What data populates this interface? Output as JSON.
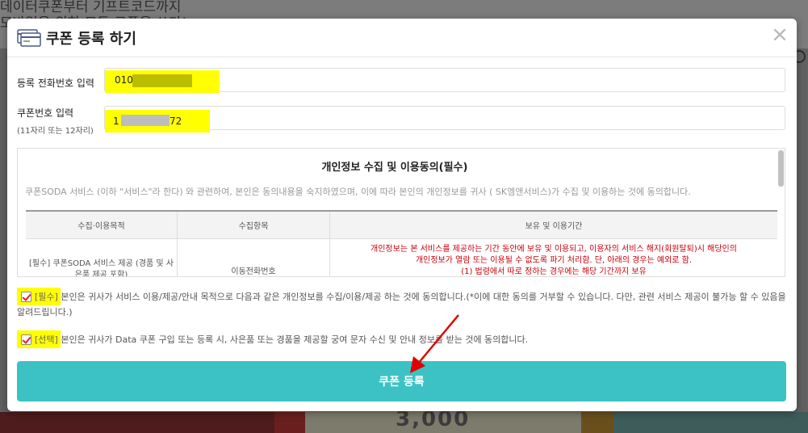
{
  "background": {
    "line1": "데이터쿠폰부터 기프트코드까지",
    "line2": "모바일을 위한 모든 쿠폰을 쓰다!",
    "bottom_amount": "3,000"
  },
  "modal": {
    "title": "쿠폰 등록 하기",
    "close_glyph": "×"
  },
  "form": {
    "phone_label": "등록 전화번호 입력",
    "phone_value": "010",
    "coupon_label": "쿠폰번호 입력",
    "coupon_sub": "(11자리 또는 12자리)",
    "coupon_value_start": "1",
    "coupon_value_end": "72"
  },
  "terms": {
    "title": "개인정보 수집 및 이용동의(필수)",
    "description": "쿠폰SODA 서비스 (이하 \"서비스\"라 한다) 와 관련하여, 본인은 동의내용을 숙지하였으며, 이에 따라 본인의 개인정보를 귀사 ( SK엠앤서비스)가 수집 및 이용하는 것에 동의합니다.",
    "headers": [
      "수집·이용목적",
      "수집항목",
      "보유 및 이용기간"
    ],
    "row": {
      "purpose": "[필수] 쿠폰SODA 서비스 제공 (경품 및 사은품 제공 포함)",
      "items": "이동전화번호",
      "retention_1": "개인정보는 본 서비스를 제공하는 기간 동안에 보유 및 이용되고, 이용자의 서비스 해지(회원탈퇴)시 해당인의",
      "retention_2": "개인정보가 열람 또는 이용될 수 없도록 파기 처리함. 단, 아래의 경우는 예외로 함.",
      "retention_3": "(1) 법령에서 따로 정하는 경우에는 해당 기간까지 보유"
    }
  },
  "agreements": {
    "required_tag": "[필수]",
    "required_text": " 본인은 귀사가 서비스 이용/제공/안내 목적으로 다음과 같은 개인정보를 수집/이용/제공 하는 것에 동의합니다.(*이에 대한 동의를 거부할 수 있습니다. 다만, 관련 서비스 제공이 불가능 할 수 있음을 알려드립니다.)",
    "optional_tag": "[선택]",
    "optional_text": " 본인은 귀사가 Data 쿠폰 구입 또는 등록 시, 사은품 또는 경품을 제공할 궁여 문자 수신 및 안내 정보를 받는 것에 동의합니다."
  },
  "submit": {
    "label": "쿠폰 등록"
  },
  "colors": {
    "accent": "#3cc2c4",
    "highlight": "#ffff00",
    "retention_text": "#c8000a",
    "arrow": "#e00000"
  },
  "icons": {
    "header": "coupon-card-icon",
    "close": "close-icon",
    "check": "checkmark-icon",
    "annotation": "red-arrow"
  }
}
